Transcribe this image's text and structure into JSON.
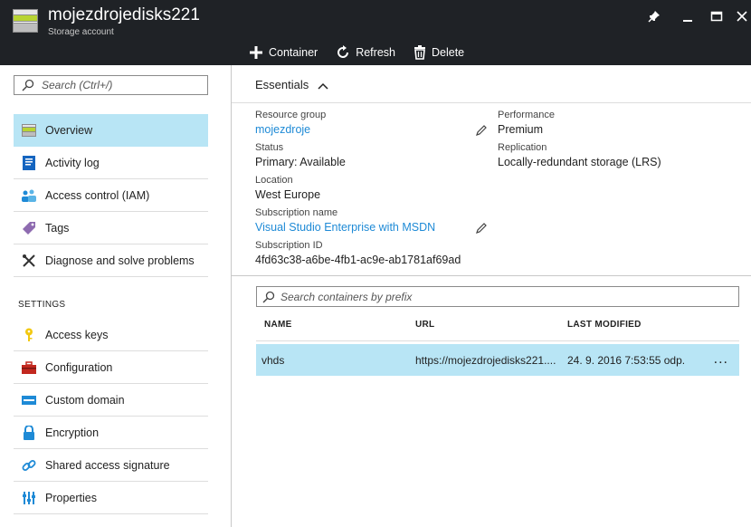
{
  "header": {
    "title": "mojezdrojedisks221",
    "subtitle": "Storage account"
  },
  "toolbar": {
    "container_label": "Container",
    "refresh_label": "Refresh",
    "delete_label": "Delete"
  },
  "sidebar": {
    "search_placeholder": "Search (Ctrl+/)",
    "items": [
      {
        "label": "Overview",
        "icon": "storage-icon"
      },
      {
        "label": "Activity log",
        "icon": "log-icon"
      },
      {
        "label": "Access control (IAM)",
        "icon": "users-icon"
      },
      {
        "label": "Tags",
        "icon": "tag-icon"
      },
      {
        "label": "Diagnose and solve problems",
        "icon": "wrench-icon"
      }
    ],
    "settings_label": "SETTINGS",
    "settings_items": [
      {
        "label": "Access keys",
        "icon": "key-icon"
      },
      {
        "label": "Configuration",
        "icon": "toolbox-icon"
      },
      {
        "label": "Custom domain",
        "icon": "domain-icon"
      },
      {
        "label": "Encryption",
        "icon": "lock-icon"
      },
      {
        "label": "Shared access signature",
        "icon": "link-icon"
      },
      {
        "label": "Properties",
        "icon": "properties-icon"
      }
    ]
  },
  "essentials": {
    "title": "Essentials",
    "resource_group_label": "Resource group",
    "resource_group_value": "mojezdroje",
    "status_label": "Status",
    "status_value": "Primary: Available",
    "location_label": "Location",
    "location_value": "West Europe",
    "subscription_name_label": "Subscription name",
    "subscription_name_value": "Visual Studio Enterprise with MSDN",
    "subscription_id_label": "Subscription ID",
    "subscription_id_value": "4fd63c38-a6be-4fb1-ac9e-ab1781af69ad",
    "performance_label": "Performance",
    "performance_value": "Premium",
    "replication_label": "Replication",
    "replication_value": "Locally-redundant storage (LRS)"
  },
  "containers": {
    "search_placeholder": "Search containers by prefix",
    "columns": [
      "NAME",
      "URL",
      "LAST MODIFIED"
    ],
    "rows": [
      {
        "name": "vhds",
        "url": "https://mojezdrojedisks221....",
        "modified": "24. 9. 2016 7:53:55 odp."
      }
    ],
    "more_label": "..."
  },
  "colors": {
    "header_bg": "#1f2226",
    "selected_bg": "#b8e5f5",
    "link": "#1e8ad6"
  }
}
